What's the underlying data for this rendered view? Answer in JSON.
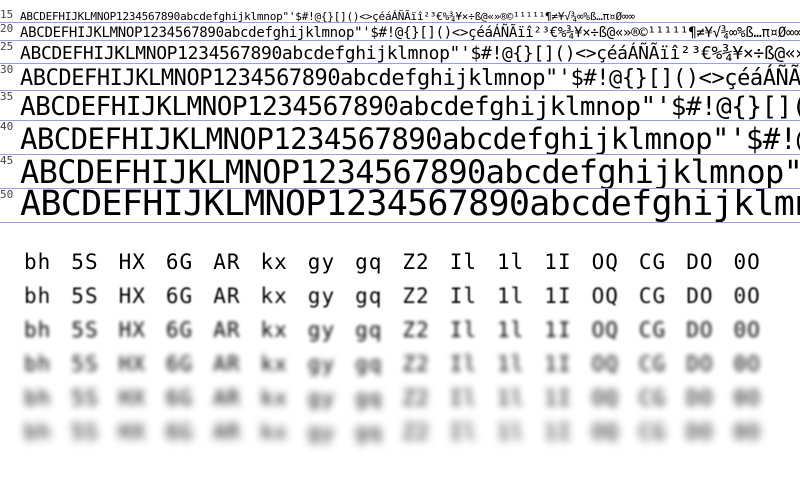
{
  "specimen": {
    "sample_text": "ABCDEFHIJKLMNOP1234567890abcdefghijklmnop\"'$#!@{}[]()<>çéáÁÑÃïî²³€%¾¥×÷ß@«»®©¹¹¹¹¹¶≠¥√¾∞%ß…π¤Ø∞∞",
    "sizes": [
      "15",
      "20",
      "25",
      "30",
      "35",
      "40",
      "45",
      "50"
    ]
  },
  "blur_test": {
    "pairs": [
      "bh",
      "5S",
      "HX",
      "6G",
      "AR",
      "kx",
      "gy",
      "gq",
      "Z2",
      "Il",
      "1l",
      "1I",
      "OQ",
      "CG",
      "DO",
      "0O"
    ],
    "levels": 6
  },
  "colors": {
    "guide_line": "#9a9ce8",
    "text": "#000000",
    "background": "#ffffff"
  }
}
